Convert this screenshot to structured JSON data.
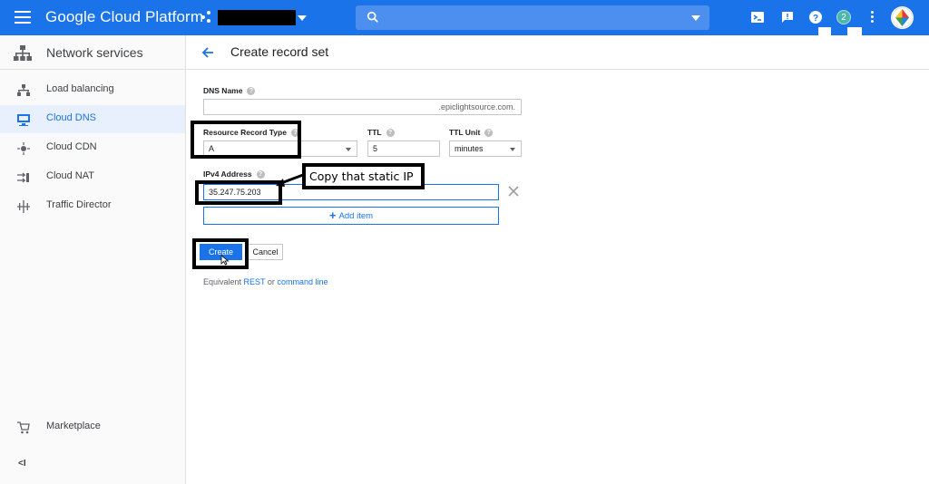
{
  "topbar": {
    "brand": "Google Cloud Platform",
    "notification_count": "2"
  },
  "sidebar": {
    "title": "Network services",
    "items": [
      {
        "label": "Load balancing",
        "icon": "load-balancing-icon"
      },
      {
        "label": "Cloud DNS",
        "icon": "cloud-dns-icon",
        "active": true
      },
      {
        "label": "Cloud CDN",
        "icon": "cloud-cdn-icon"
      },
      {
        "label": "Cloud NAT",
        "icon": "cloud-nat-icon"
      },
      {
        "label": "Traffic Director",
        "icon": "traffic-director-icon"
      }
    ],
    "marketplace": "Marketplace",
    "collapse_label": "<I"
  },
  "page": {
    "title": "Create record set"
  },
  "form": {
    "dns_name_label": "DNS Name",
    "dns_name_value": "",
    "dns_name_suffix": ".epiclightsource.com.",
    "rrtype_label": "Resource Record Type",
    "rrtype_value": "A",
    "ttl_label": "TTL",
    "ttl_value": "5",
    "ttl_unit_label": "TTL Unit",
    "ttl_unit_value": "minutes",
    "ipv4_label": "IPv4 Address",
    "ipv4_value": "35.247.75.203",
    "add_item": "Add item",
    "create": "Create",
    "cancel": "Cancel",
    "equiv_prefix": "Equivalent",
    "equiv_rest": "REST",
    "equiv_or": "or",
    "equiv_cmd": "command line"
  },
  "annotation": {
    "callout": "Copy that static IP"
  },
  "colors": {
    "accent": "#1a73e8",
    "topbar": "#1a73e8",
    "active_bg": "#e8f0fe"
  }
}
